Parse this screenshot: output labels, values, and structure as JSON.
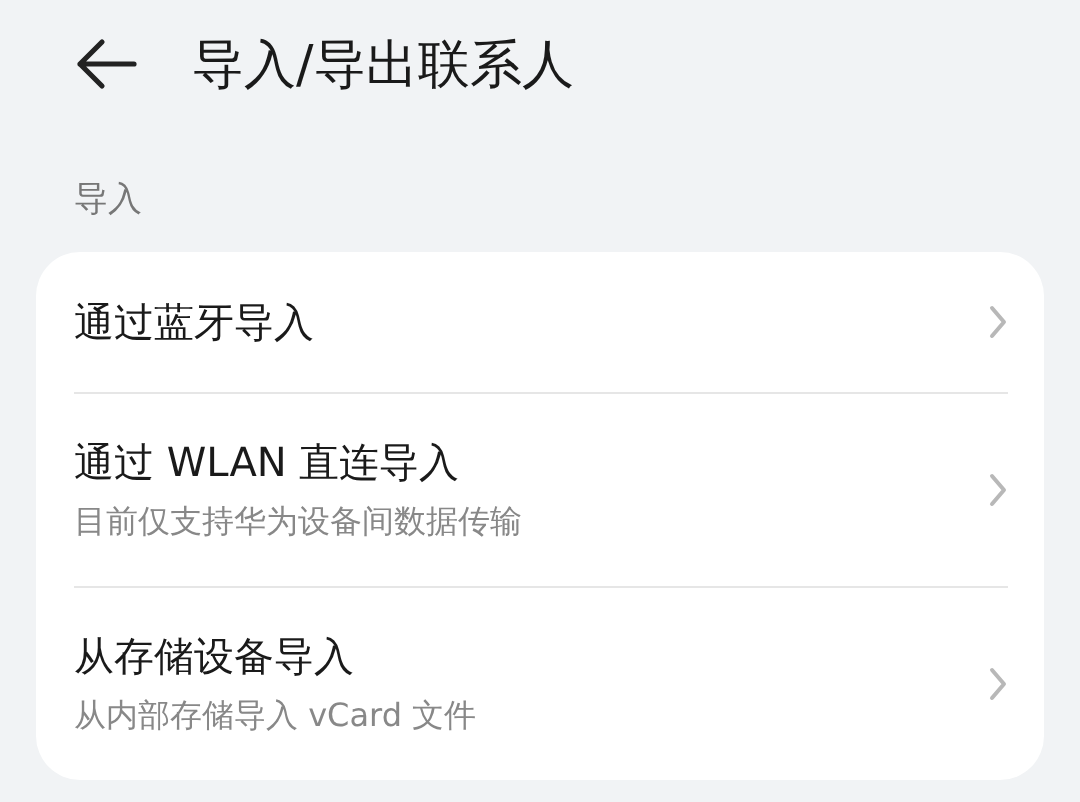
{
  "header": {
    "title": "导入/导出联系人"
  },
  "section": {
    "label": "导入"
  },
  "items": [
    {
      "title": "通过蓝牙导入"
    },
    {
      "title": "通过 WLAN 直连导入",
      "subtitle": "目前仅支持华为设备间数据传输"
    },
    {
      "title": "从存储设备导入",
      "subtitle": "从内部存储导入 vCard 文件"
    }
  ]
}
